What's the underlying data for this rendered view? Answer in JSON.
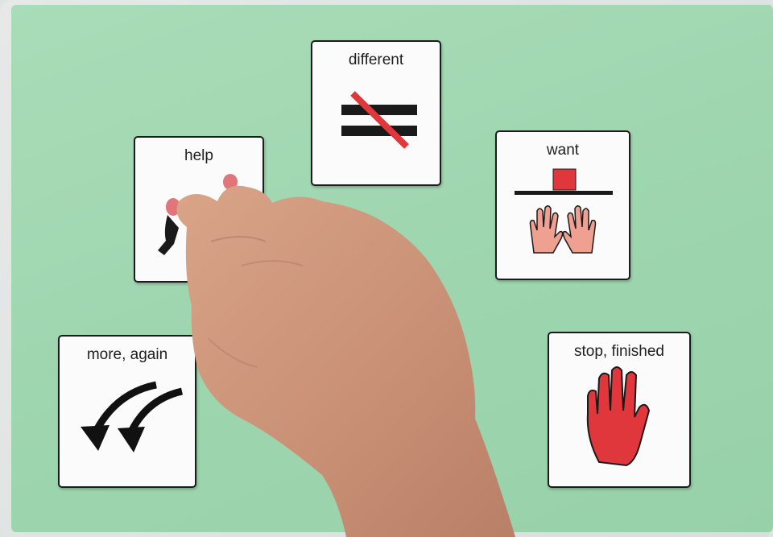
{
  "cards": {
    "different": {
      "label": "different",
      "icon": "not-equal-icon"
    },
    "help": {
      "label": "help",
      "icon": "helping-people-icon"
    },
    "want": {
      "label": "want",
      "icon": "reaching-hands-icon"
    },
    "more": {
      "label": "more, again",
      "icon": "curved-arrows-icon"
    },
    "stop": {
      "label": "stop, finished",
      "icon": "stop-hand-icon"
    }
  },
  "colors": {
    "board": "#9fd6b0",
    "card": "#fbfbfb",
    "accent_red": "#e0373d",
    "skin": "#d9a488"
  }
}
